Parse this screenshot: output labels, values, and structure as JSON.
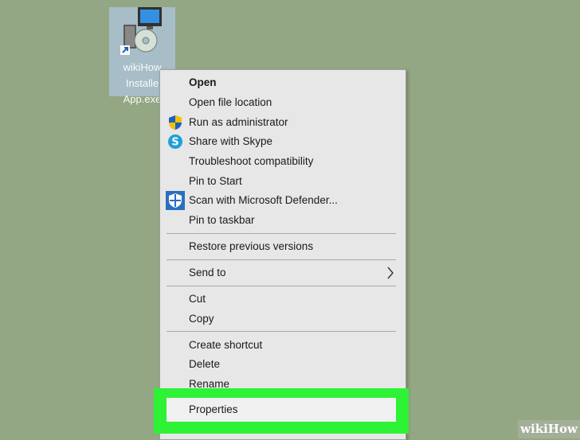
{
  "desktop_icon": {
    "lines": [
      "wikiHow",
      "Installe",
      "App.exe"
    ],
    "icon": "installer-icon"
  },
  "menu": {
    "items": [
      {
        "label": "Open",
        "bold": true
      },
      {
        "label": "Open file location"
      },
      {
        "label": "Run as administrator",
        "icon": "uac-shield-icon"
      },
      {
        "label": "Share with Skype",
        "icon": "skype-icon"
      },
      {
        "label": "Troubleshoot compatibility"
      },
      {
        "label": "Pin to Start"
      },
      {
        "label": "Scan with Microsoft Defender...",
        "icon": "defender-shield-icon"
      },
      {
        "label": "Pin to taskbar"
      },
      {
        "label": "Restore previous versions"
      },
      {
        "label": "Send to",
        "submenu": true
      },
      {
        "label": "Cut"
      },
      {
        "label": "Copy"
      },
      {
        "label": "Create shortcut"
      },
      {
        "label": "Delete"
      },
      {
        "label": "Rename"
      },
      {
        "label": "Properties",
        "highlighted": true
      }
    ]
  },
  "watermark": {
    "prefix": "wiki",
    "suffix": "How"
  },
  "colors": {
    "desktop": "#94a784",
    "menu": "#e7e7e7",
    "highlight": "#2ef236"
  }
}
